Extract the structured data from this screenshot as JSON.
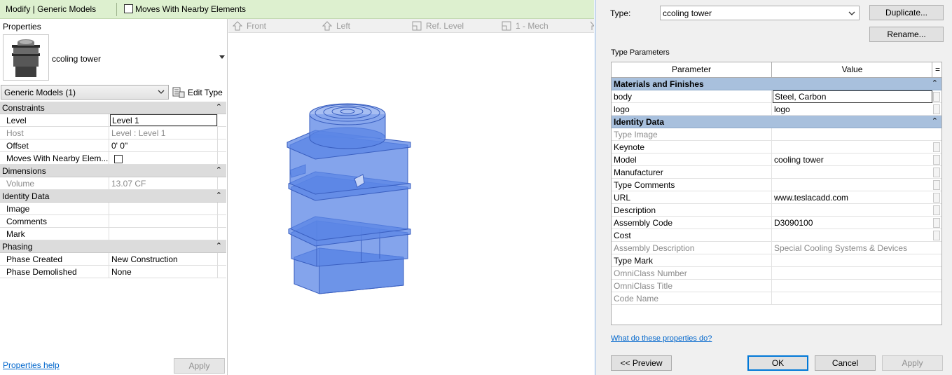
{
  "ribbon": {
    "context": "Modify | Generic Models",
    "moves_with_nearby": "Moves With Nearby Elements"
  },
  "properties": {
    "title": "Properties",
    "type_name": "ccoling tower",
    "filter": "Generic Models (1)",
    "edit_type": "Edit Type",
    "sections": [
      {
        "name": "Constraints",
        "rows": [
          {
            "param": "Level",
            "value": "Level 1"
          },
          {
            "param": "Host",
            "value": "Level : Level 1"
          },
          {
            "param": "Offset",
            "value": "0'  0\""
          },
          {
            "param": "Moves With Nearby Elem...",
            "value": ""
          }
        ]
      },
      {
        "name": "Dimensions",
        "rows": [
          {
            "param": "Volume",
            "value": "13.07 CF"
          }
        ]
      },
      {
        "name": "Identity Data",
        "rows": [
          {
            "param": "Image",
            "value": ""
          },
          {
            "param": "Comments",
            "value": ""
          },
          {
            "param": "Mark",
            "value": ""
          }
        ]
      },
      {
        "name": "Phasing",
        "rows": [
          {
            "param": "Phase Created",
            "value": "New Construction"
          },
          {
            "param": "Phase Demolished",
            "value": "None"
          }
        ]
      }
    ],
    "help_link": "Properties help",
    "apply": "Apply"
  },
  "viewport": {
    "tabs": [
      "Front",
      "Left",
      "Ref. Level",
      "1 - Mech"
    ],
    "model_color": "#4a78e0"
  },
  "dialog": {
    "type_label": "Type:",
    "type_value": "ccoling tower",
    "duplicate": "Duplicate...",
    "rename": "Rename...",
    "type_parameters": "Type Parameters",
    "col_param": "Parameter",
    "col_value": "Value",
    "col_eq": "=",
    "sections": [
      {
        "name": "Materials and Finishes",
        "rows": [
          {
            "param": "body",
            "value": "Steel, Carbon"
          },
          {
            "param": "logo",
            "value": "logo"
          }
        ]
      },
      {
        "name": "Identity Data",
        "rows": [
          {
            "param": "Type Image",
            "value": ""
          },
          {
            "param": "Keynote",
            "value": ""
          },
          {
            "param": "Model",
            "value": "cooling tower"
          },
          {
            "param": "Manufacturer",
            "value": ""
          },
          {
            "param": "Type Comments",
            "value": ""
          },
          {
            "param": "URL",
            "value": "www.teslacadd.com"
          },
          {
            "param": "Description",
            "value": ""
          },
          {
            "param": "Assembly Code",
            "value": "D3090100"
          },
          {
            "param": "Cost",
            "value": ""
          },
          {
            "param": "Assembly Description",
            "value": "Special Cooling Systems & Devices"
          },
          {
            "param": "Type Mark",
            "value": ""
          },
          {
            "param": "OmniClass Number",
            "value": ""
          },
          {
            "param": "OmniClass Title",
            "value": ""
          },
          {
            "param": "Code Name",
            "value": ""
          }
        ]
      }
    ],
    "help_link": "What do these properties do?",
    "preview": "<< Preview",
    "ok": "OK",
    "cancel": "Cancel",
    "apply": "Apply"
  }
}
